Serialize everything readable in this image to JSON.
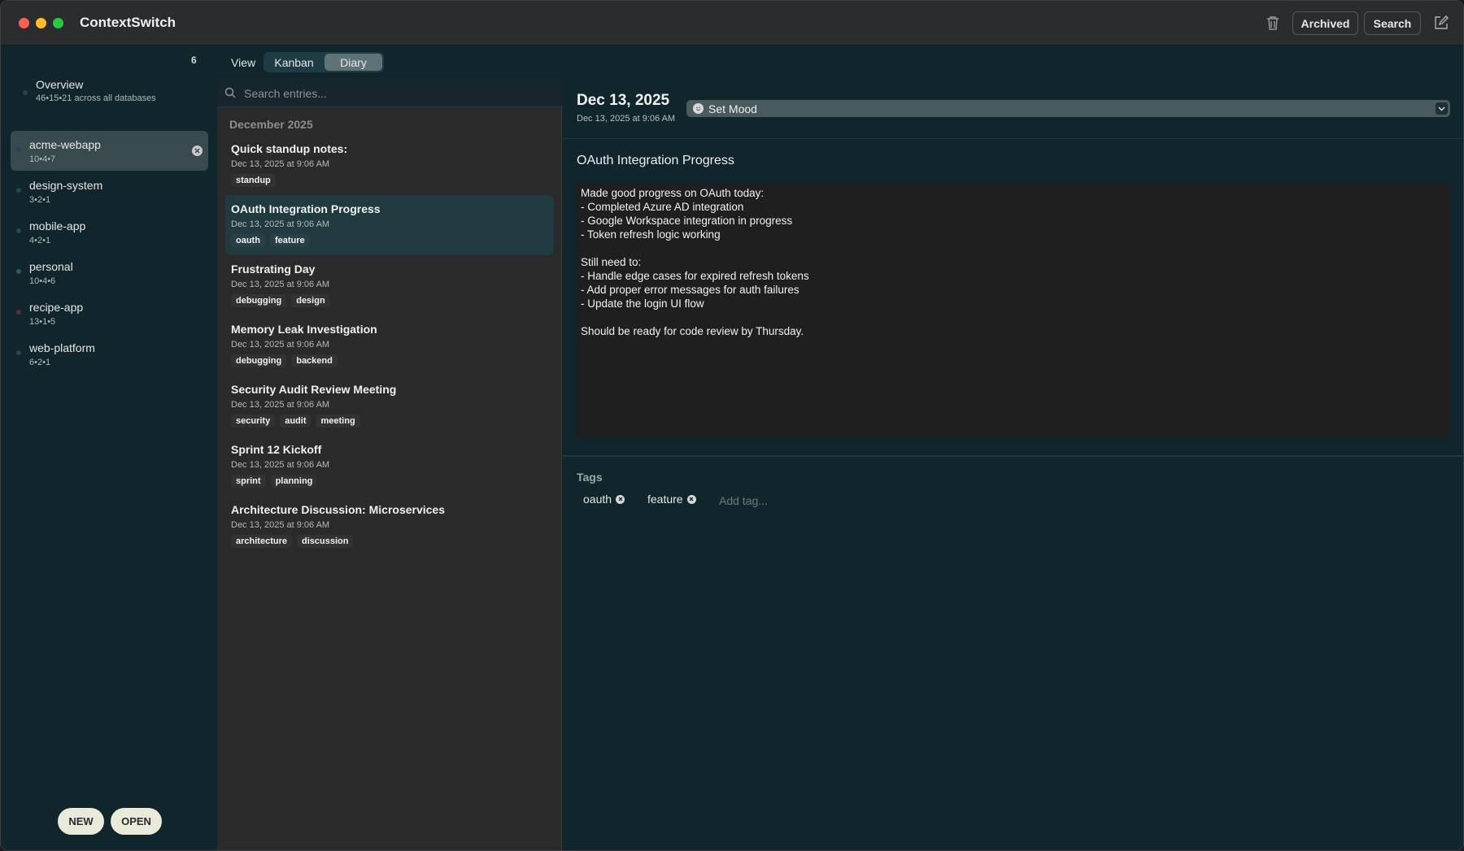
{
  "app": {
    "title": "ContextSwitch"
  },
  "toolbar": {
    "archived_label": "Archived",
    "search_label": "Search",
    "trash_icon": "trash-icon",
    "compose_icon": "compose-icon"
  },
  "sidebar": {
    "database_count": "6",
    "overview": {
      "title": "Overview",
      "subtitle": "46•15•21 across all databases"
    },
    "databases": [
      {
        "name": "acme-webapp",
        "stats": "10•4•7",
        "dot_color": "#1d4550",
        "selected": true
      },
      {
        "name": "design-system",
        "stats": "3•2•1",
        "dot_color": "#244750"
      },
      {
        "name": "mobile-app",
        "stats": "4•2•1",
        "dot_color": "#244750"
      },
      {
        "name": "personal",
        "stats": "10•4•6",
        "dot_color": "#2e5a5a"
      },
      {
        "name": "recipe-app",
        "stats": "13•1•5",
        "dot_color": "#5a2f35"
      },
      {
        "name": "web-platform",
        "stats": "6•2•1",
        "dot_color": "#244750"
      }
    ],
    "new_label": "NEW",
    "open_label": "OPEN"
  },
  "view": {
    "label": "View",
    "options": [
      "Kanban",
      "Diary"
    ],
    "selected": "Diary"
  },
  "list": {
    "search_placeholder": "Search entries...",
    "month": "December 2025",
    "entries": [
      {
        "title": "Quick standup notes:",
        "date": "Dec 13, 2025 at 9:06 AM",
        "tags": [
          "standup"
        ]
      },
      {
        "title": "OAuth Integration Progress",
        "date": "Dec 13, 2025 at 9:06 AM",
        "tags": [
          "oauth",
          "feature"
        ],
        "selected": true
      },
      {
        "title": "Frustrating Day",
        "date": "Dec 13, 2025 at 9:06 AM",
        "tags": [
          "debugging",
          "design"
        ]
      },
      {
        "title": "Memory Leak Investigation",
        "date": "Dec 13, 2025 at 9:06 AM",
        "tags": [
          "debugging",
          "backend"
        ]
      },
      {
        "title": "Security Audit Review Meeting",
        "date": "Dec 13, 2025 at 9:06 AM",
        "tags": [
          "security",
          "audit",
          "meeting"
        ]
      },
      {
        "title": "Sprint 12 Kickoff",
        "date": "Dec 13, 2025 at 9:06 AM",
        "tags": [
          "sprint",
          "planning"
        ]
      },
      {
        "title": "Architecture Discussion: Microservices",
        "date": "Dec 13, 2025 at 9:06 AM",
        "tags": [
          "architecture",
          "discussion"
        ]
      }
    ]
  },
  "detail": {
    "date": "Dec 13, 2025",
    "datetime": "Dec 13, 2025 at 9:06 AM",
    "mood_label": "Set Mood",
    "title": "OAuth Integration Progress",
    "body": "Made good progress on OAuth today:\n- Completed Azure AD integration\n- Google Workspace integration in progress\n- Token refresh logic working\n\nStill need to:\n- Handle edge cases for expired refresh tokens\n- Add proper error messages for auth failures\n- Update the login UI flow\n\nShould be ready for code review by Thursday.",
    "tags_label": "Tags",
    "tags": [
      "oauth",
      "feature"
    ],
    "add_tag_placeholder": "Add tag..."
  }
}
